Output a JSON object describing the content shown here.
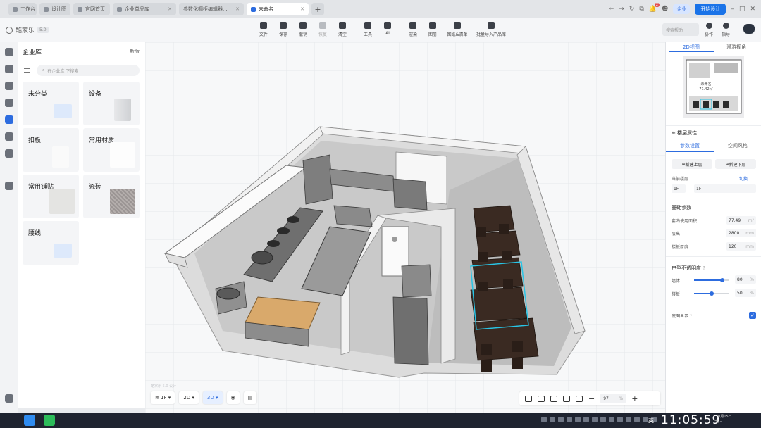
{
  "browser_tabs": [
    {
      "label": "工作台",
      "active": false
    },
    {
      "label": "设计图",
      "active": false
    },
    {
      "label": "官网首页",
      "active": false
    },
    {
      "label": "企业单品库",
      "active": false
    },
    {
      "label": "参数化橱柜编辑器...",
      "active": false
    },
    {
      "label": "未命名",
      "active": true
    }
  ],
  "browser_right": {
    "notification_count": "2",
    "enterprise_label": "企业",
    "start_design_label": "开始设计"
  },
  "app": {
    "logo_text": "酷家乐",
    "version_badge": "5.0"
  },
  "toolbar": [
    {
      "label": "文件",
      "icon": "file-icon"
    },
    {
      "label": "保存",
      "icon": "save-icon"
    },
    {
      "label": "撤销",
      "icon": "undo-icon"
    },
    {
      "label": "恢复",
      "icon": "redo-icon",
      "disabled": true
    },
    {
      "label": "清空",
      "icon": "clear-icon"
    },
    {
      "label": "工具",
      "icon": "wrench-icon"
    },
    {
      "label": "AI",
      "icon": "ai-icon"
    },
    {
      "label": "渲染",
      "icon": "render-icon"
    },
    {
      "label": "图册",
      "icon": "album-icon"
    },
    {
      "label": "图纸&清单",
      "icon": "drawing-list-icon"
    },
    {
      "label": "批量导入产品库",
      "icon": "batch-import-icon"
    }
  ],
  "header_right": {
    "search_placeholder": "搜索帮助",
    "collab_label": "协作",
    "guide_label": "指导"
  },
  "library": {
    "title": "企业库",
    "new_label": "新版",
    "search_placeholder": "在企业库 下搜索",
    "cards": [
      {
        "label": "未分类",
        "thumb": "folder"
      },
      {
        "label": "设备",
        "thumb": "device"
      },
      {
        "label": "扣板",
        "thumb": "panel"
      },
      {
        "label": "常用材质",
        "thumb": "material"
      },
      {
        "label": "常用铺贴",
        "thumb": "tile"
      },
      {
        "label": "瓷砖",
        "thumb": "ceramic"
      },
      {
        "label": "腰线",
        "thumb": "folder"
      }
    ]
  },
  "canvas": {
    "floor_label": "1F",
    "view_2d": "2D",
    "view_3d": "3D",
    "zoom_value": "97",
    "zoom_unit": "%",
    "watermark": "酷家乐 5.0 设计"
  },
  "right_panel": {
    "view_tabs": [
      "2D视图",
      "漫游视角"
    ],
    "minimap_area_label": "未命名",
    "minimap_area_value": "71.42㎡",
    "section_title": "楼层属性",
    "sub_tabs": [
      "参数设置",
      "空间风格"
    ],
    "new_upper_floor": "新建上层",
    "new_lower_floor": "新建下层",
    "current_floor_label": "当前楼层",
    "floor_switch_label": "切换",
    "floor_code": "1F",
    "floor_name": "1F",
    "basic_params_label": "基础参数",
    "indoor_area_label": "套内使用面积",
    "indoor_area_value": "77.49",
    "indoor_area_unit": "m²",
    "height_label": "层高",
    "height_value": "2800",
    "height_unit": "mm",
    "slab_label": "楼板厚度",
    "slab_value": "120",
    "slab_unit": "mm",
    "opacity_label": "户型不透明度",
    "opacity_badge": "?",
    "wall_label": "墙体",
    "wall_value": "80",
    "wall_pct": 80,
    "floor_op_label": "楼板",
    "floor_op_value": "50",
    "floor_op_pct": 50,
    "percent_unit": "%",
    "ground_display_label": "底图显示",
    "ground_display_badge": "?",
    "ground_display_checked": true
  },
  "taskbar": {
    "ime": "英",
    "clock": "11:05:59",
    "date_line1": "10月15日",
    "date_line2": "周三"
  },
  "colors": {
    "accent": "#2d6cdf",
    "selection": "#29c5e6",
    "countertop": "#d9a96b",
    "furniture_dark": "#3a2a22",
    "appliance": "#8a8a8a"
  }
}
